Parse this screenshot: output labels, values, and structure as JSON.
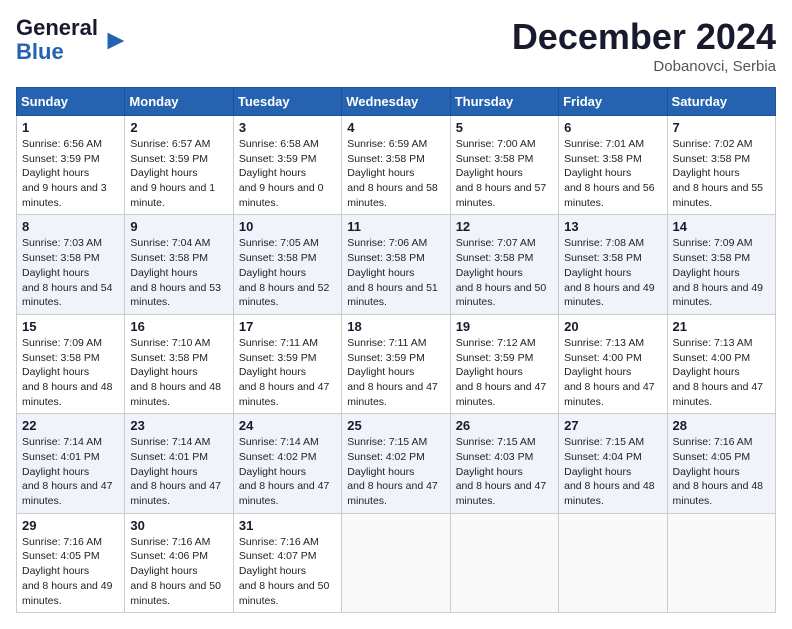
{
  "header": {
    "logo_line1": "General",
    "logo_line2": "Blue",
    "month_title": "December 2024",
    "location": "Dobanovci, Serbia"
  },
  "weekdays": [
    "Sunday",
    "Monday",
    "Tuesday",
    "Wednesday",
    "Thursday",
    "Friday",
    "Saturday"
  ],
  "weeks": [
    [
      {
        "day": "1",
        "sunrise": "6:56 AM",
        "sunset": "3:59 PM",
        "daylight": "9 hours and 3 minutes."
      },
      {
        "day": "2",
        "sunrise": "6:57 AM",
        "sunset": "3:59 PM",
        "daylight": "9 hours and 1 minute."
      },
      {
        "day": "3",
        "sunrise": "6:58 AM",
        "sunset": "3:59 PM",
        "daylight": "9 hours and 0 minutes."
      },
      {
        "day": "4",
        "sunrise": "6:59 AM",
        "sunset": "3:58 PM",
        "daylight": "8 hours and 58 minutes."
      },
      {
        "day": "5",
        "sunrise": "7:00 AM",
        "sunset": "3:58 PM",
        "daylight": "8 hours and 57 minutes."
      },
      {
        "day": "6",
        "sunrise": "7:01 AM",
        "sunset": "3:58 PM",
        "daylight": "8 hours and 56 minutes."
      },
      {
        "day": "7",
        "sunrise": "7:02 AM",
        "sunset": "3:58 PM",
        "daylight": "8 hours and 55 minutes."
      }
    ],
    [
      {
        "day": "8",
        "sunrise": "7:03 AM",
        "sunset": "3:58 PM",
        "daylight": "8 hours and 54 minutes."
      },
      {
        "day": "9",
        "sunrise": "7:04 AM",
        "sunset": "3:58 PM",
        "daylight": "8 hours and 53 minutes."
      },
      {
        "day": "10",
        "sunrise": "7:05 AM",
        "sunset": "3:58 PM",
        "daylight": "8 hours and 52 minutes."
      },
      {
        "day": "11",
        "sunrise": "7:06 AM",
        "sunset": "3:58 PM",
        "daylight": "8 hours and 51 minutes."
      },
      {
        "day": "12",
        "sunrise": "7:07 AM",
        "sunset": "3:58 PM",
        "daylight": "8 hours and 50 minutes."
      },
      {
        "day": "13",
        "sunrise": "7:08 AM",
        "sunset": "3:58 PM",
        "daylight": "8 hours and 49 minutes."
      },
      {
        "day": "14",
        "sunrise": "7:09 AM",
        "sunset": "3:58 PM",
        "daylight": "8 hours and 49 minutes."
      }
    ],
    [
      {
        "day": "15",
        "sunrise": "7:09 AM",
        "sunset": "3:58 PM",
        "daylight": "8 hours and 48 minutes."
      },
      {
        "day": "16",
        "sunrise": "7:10 AM",
        "sunset": "3:58 PM",
        "daylight": "8 hours and 48 minutes."
      },
      {
        "day": "17",
        "sunrise": "7:11 AM",
        "sunset": "3:59 PM",
        "daylight": "8 hours and 47 minutes."
      },
      {
        "day": "18",
        "sunrise": "7:11 AM",
        "sunset": "3:59 PM",
        "daylight": "8 hours and 47 minutes."
      },
      {
        "day": "19",
        "sunrise": "7:12 AM",
        "sunset": "3:59 PM",
        "daylight": "8 hours and 47 minutes."
      },
      {
        "day": "20",
        "sunrise": "7:13 AM",
        "sunset": "4:00 PM",
        "daylight": "8 hours and 47 minutes."
      },
      {
        "day": "21",
        "sunrise": "7:13 AM",
        "sunset": "4:00 PM",
        "daylight": "8 hours and 47 minutes."
      }
    ],
    [
      {
        "day": "22",
        "sunrise": "7:14 AM",
        "sunset": "4:01 PM",
        "daylight": "8 hours and 47 minutes."
      },
      {
        "day": "23",
        "sunrise": "7:14 AM",
        "sunset": "4:01 PM",
        "daylight": "8 hours and 47 minutes."
      },
      {
        "day": "24",
        "sunrise": "7:14 AM",
        "sunset": "4:02 PM",
        "daylight": "8 hours and 47 minutes."
      },
      {
        "day": "25",
        "sunrise": "7:15 AM",
        "sunset": "4:02 PM",
        "daylight": "8 hours and 47 minutes."
      },
      {
        "day": "26",
        "sunrise": "7:15 AM",
        "sunset": "4:03 PM",
        "daylight": "8 hours and 47 minutes."
      },
      {
        "day": "27",
        "sunrise": "7:15 AM",
        "sunset": "4:04 PM",
        "daylight": "8 hours and 48 minutes."
      },
      {
        "day": "28",
        "sunrise": "7:16 AM",
        "sunset": "4:05 PM",
        "daylight": "8 hours and 48 minutes."
      }
    ],
    [
      {
        "day": "29",
        "sunrise": "7:16 AM",
        "sunset": "4:05 PM",
        "daylight": "8 hours and 49 minutes."
      },
      {
        "day": "30",
        "sunrise": "7:16 AM",
        "sunset": "4:06 PM",
        "daylight": "8 hours and 50 minutes."
      },
      {
        "day": "31",
        "sunrise": "7:16 AM",
        "sunset": "4:07 PM",
        "daylight": "8 hours and 50 minutes."
      },
      null,
      null,
      null,
      null
    ]
  ]
}
